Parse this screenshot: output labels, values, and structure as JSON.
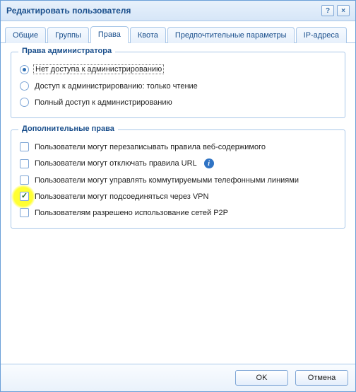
{
  "window": {
    "title": "Редактировать пользователя"
  },
  "tabs": {
    "items": [
      {
        "label": "Общие"
      },
      {
        "label": "Группы"
      },
      {
        "label": "Права"
      },
      {
        "label": "Квота"
      },
      {
        "label": "Предпочтительные параметры"
      },
      {
        "label": "IP-адреса"
      }
    ],
    "active_index": 2
  },
  "admin_rights": {
    "legend": "Права администратора",
    "options": [
      {
        "label": "Нет доступа к администрированию",
        "selected": true
      },
      {
        "label": "Доступ к администрированию: только чтение",
        "selected": false
      },
      {
        "label": "Полный доступ к администрированию",
        "selected": false
      }
    ]
  },
  "extra_rights": {
    "legend": "Дополнительные права",
    "options": [
      {
        "label": "Пользователи могут перезаписывать правила веб-содержимого",
        "checked": false,
        "info": false,
        "highlight": false
      },
      {
        "label": "Пользователи могут отключать правила URL",
        "checked": false,
        "info": true,
        "highlight": false
      },
      {
        "label": "Пользователи могут управлять коммутируемыми телефонными линиями",
        "checked": false,
        "info": false,
        "highlight": false
      },
      {
        "label": "Пользователи могут подсоединяться через VPN",
        "checked": true,
        "info": false,
        "highlight": true
      },
      {
        "label": "Пользователям разрешено использование сетей P2P",
        "checked": false,
        "info": false,
        "highlight": false
      }
    ]
  },
  "buttons": {
    "ok": "OK",
    "cancel": "Отмена"
  },
  "icons": {
    "help": "?",
    "close": "×",
    "info": "i"
  }
}
